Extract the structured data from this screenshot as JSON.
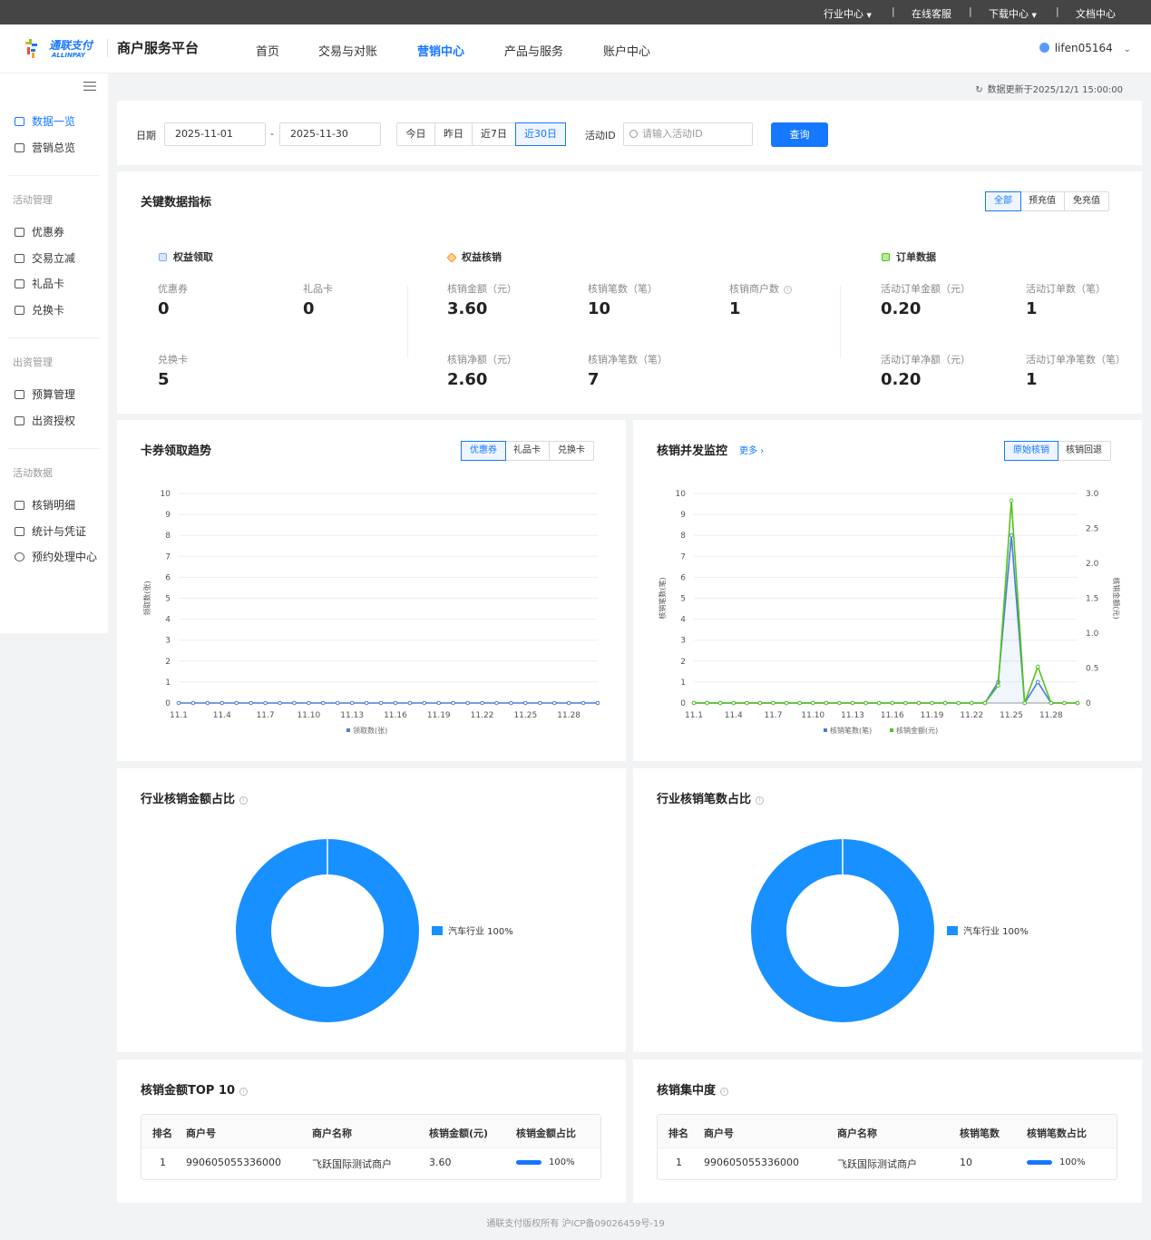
{
  "topbar": {
    "industry": "行业中心",
    "service": "在线客服",
    "download": "下载中心",
    "docs": "文档中心",
    "sep": "|"
  },
  "header": {
    "logo_cn": "通联支付",
    "logo_en": "ALLINPAY",
    "platform": "商户服务平台",
    "nav": [
      "首页",
      "交易与对账",
      "营销中心",
      "产品与服务",
      "账户中心"
    ],
    "active_nav": "营销中心",
    "username": "lifen05164"
  },
  "sidebar": {
    "items_top": [
      "数据一览",
      "营销总览"
    ],
    "group_activity": "活动管理",
    "items_activity": [
      "优惠券",
      "交易立减",
      "礼品卡",
      "兑换卡"
    ],
    "group_funding": "出资管理",
    "items_funding": [
      "预算管理",
      "出资授权"
    ],
    "group_data": "活动数据",
    "items_data": [
      "核销明细",
      "统计与凭证",
      "预约处理中心"
    ]
  },
  "update_text": "数据更新于2025/12/1 15:00:00",
  "filter": {
    "date_label": "日期",
    "start_date": "2025-11-01",
    "dash": "-",
    "end_date": "2025-11-30",
    "quick": [
      "今日",
      "昨日",
      "近7日",
      "近30日"
    ],
    "quick_selected": "近30日",
    "activity_label": "活动ID",
    "activity_placeholder": "请输入活动ID",
    "query_button": "查询"
  },
  "kpi": {
    "title": "关键数据指标",
    "tabs": [
      "全部",
      "预充值",
      "免充值"
    ],
    "tab_selected": "全部",
    "claim": {
      "title": "权益领取",
      "metrics": [
        {
          "label": "优惠券",
          "value": "0"
        },
        {
          "label": "礼品卡",
          "value": "0"
        },
        {
          "label": "兑换卡",
          "value": "5"
        }
      ]
    },
    "redeem": {
      "title": "权益核销",
      "metrics": [
        {
          "label": "核销金额（元）",
          "value": "3.60"
        },
        {
          "label": "核销笔数（笔）",
          "value": "10"
        },
        {
          "label": "核销商户数",
          "value": "1"
        },
        {
          "label": "核销净额（元）",
          "value": "2.60"
        },
        {
          "label": "核销净笔数（笔）",
          "value": "7"
        }
      ]
    },
    "order": {
      "title": "订单数据",
      "metrics": [
        {
          "label": "活动订单金额（元）",
          "value": "0.20"
        },
        {
          "label": "活动订单数（笔）",
          "value": "1"
        },
        {
          "label": "活动订单净额（元）",
          "value": "0.20"
        },
        {
          "label": "活动订单净笔数（笔）",
          "value": "1"
        }
      ]
    }
  },
  "trend_card": {
    "title": "卡券领取趋势",
    "tabs": [
      "优惠券",
      "礼品卡",
      "兑换卡"
    ],
    "tab_selected": "优惠券"
  },
  "monitor_card": {
    "title": "核销并发监控",
    "more": "更多",
    "tabs": [
      "原始核销",
      "核销回退"
    ],
    "tab_selected": "原始核销"
  },
  "industry_amount": {
    "title": "行业核销金额占比",
    "legend": "汽车行业 100%"
  },
  "industry_count": {
    "title": "行业核销笔数占比",
    "legend": "汽车行业 100%"
  },
  "top10": {
    "title": "核销金额TOP 10",
    "headers": [
      "排名",
      "商户号",
      "商户名称",
      "核销金额(元)",
      "核销金额占比"
    ],
    "rows": [
      [
        "1",
        "990605055336000",
        "飞跃国际测试商户",
        "3.60",
        "100%"
      ]
    ]
  },
  "concentration": {
    "title": "核销集中度",
    "headers": [
      "排名",
      "商户号",
      "商户名称",
      "核销笔数",
      "核销笔数占比"
    ],
    "rows": [
      [
        "1",
        "990605055336000",
        "飞跃国际测试商户",
        "10",
        "100%"
      ]
    ]
  },
  "footer": "通联支付版权所有 沪ICP备09026459号-19",
  "colors": {
    "primary": "#1677ff",
    "series_blue": "#4a7bd8",
    "series_green": "#52c41a",
    "pie": "#1890ff"
  },
  "chart_data": [
    {
      "type": "line",
      "title": "卡券领取趋势",
      "ylabel": "领取数(张)",
      "ylim": [
        0,
        10
      ],
      "y_ticks": [
        "0",
        "1",
        "2",
        "3",
        "4",
        "5",
        "6",
        "7",
        "8",
        "9",
        "10"
      ],
      "x": [
        "11.1",
        "11.2",
        "11.3",
        "11.4",
        "11.5",
        "11.6",
        "11.7",
        "11.8",
        "11.9",
        "11.10",
        "11.11",
        "11.12",
        "11.13",
        "11.14",
        "11.15",
        "11.16",
        "11.17",
        "11.18",
        "11.19",
        "11.20",
        "11.21",
        "11.22",
        "11.23",
        "11.24",
        "11.25",
        "11.26",
        "11.27",
        "11.28",
        "11.29",
        "11.30"
      ],
      "x_tick_labels": [
        "11.1",
        "11.4",
        "11.7",
        "11.10",
        "11.13",
        "11.16",
        "11.19",
        "11.22",
        "11.25",
        "11.28"
      ],
      "series": [
        {
          "name": "领取数(张)",
          "values": [
            0,
            0,
            0,
            0,
            0,
            0,
            0,
            0,
            0,
            0,
            0,
            0,
            0,
            0,
            0,
            0,
            0,
            0,
            0,
            0,
            0,
            0,
            0,
            0,
            0,
            0,
            0,
            0,
            0,
            0
          ]
        }
      ],
      "legend": "bottom"
    },
    {
      "type": "line",
      "title": "核销并发监控",
      "ylabel": "核销笔数(笔)",
      "ylabel_right": "核销金额(元)",
      "ylim": [
        0,
        10
      ],
      "ylim_right": [
        0,
        3
      ],
      "y_ticks": [
        "0",
        "1",
        "2",
        "3",
        "4",
        "5",
        "6",
        "7",
        "8",
        "9",
        "10"
      ],
      "y_ticks_right": [
        "0",
        "0.5",
        "1.0",
        "1.5",
        "2.0",
        "2.5",
        "3.0"
      ],
      "x": [
        "11.1",
        "11.2",
        "11.3",
        "11.4",
        "11.5",
        "11.6",
        "11.7",
        "11.8",
        "11.9",
        "11.10",
        "11.11",
        "11.12",
        "11.13",
        "11.14",
        "11.15",
        "11.16",
        "11.17",
        "11.18",
        "11.19",
        "11.20",
        "11.21",
        "11.22",
        "11.23",
        "11.24",
        "11.25",
        "11.26",
        "11.27",
        "11.28",
        "11.29",
        "11.30"
      ],
      "x_tick_labels": [
        "11.1",
        "11.4",
        "11.7",
        "11.10",
        "11.13",
        "11.16",
        "11.19",
        "11.22",
        "11.25",
        "11.28"
      ],
      "series": [
        {
          "name": "核销笔数(笔)",
          "axis": "left",
          "values": [
            0,
            0,
            0,
            0,
            0,
            0,
            0,
            0,
            0,
            0,
            0,
            0,
            0,
            0,
            0,
            0,
            0,
            0,
            0,
            0,
            0,
            0,
            0,
            1,
            8,
            0,
            1,
            0,
            0,
            0
          ]
        },
        {
          "name": "核销金额(元)",
          "axis": "right",
          "values": [
            0,
            0,
            0,
            0,
            0,
            0,
            0,
            0,
            0,
            0,
            0,
            0,
            0,
            0,
            0,
            0,
            0,
            0,
            0,
            0,
            0,
            0,
            0,
            0.25,
            2.9,
            0,
            0.52,
            0,
            0,
            0
          ]
        }
      ],
      "legend": "bottom"
    },
    {
      "type": "pie",
      "title": "行业核销金额占比",
      "categories": [
        "汽车行业"
      ],
      "values": [
        100
      ]
    },
    {
      "type": "pie",
      "title": "行业核销笔数占比",
      "categories": [
        "汽车行业"
      ],
      "values": [
        100
      ]
    }
  ]
}
